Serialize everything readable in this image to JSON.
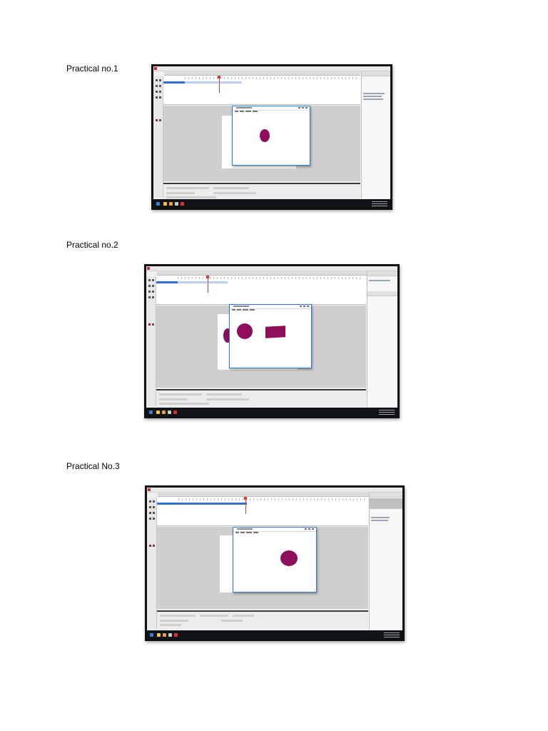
{
  "captions": [
    "Practical no.1",
    "Practical no.2",
    "Practical No.3"
  ],
  "shape_color": "#8e0e5c",
  "screenshots": [
    {
      "content": "Flash authoring window with test movie showing one ellipse",
      "shapes": [
        "ellipse"
      ]
    },
    {
      "content": "Flash authoring window with test movie showing two ellipses and a rectangle",
      "shapes": [
        "ellipse",
        "ellipse",
        "rectangle"
      ]
    },
    {
      "content": "Flash authoring window with test movie showing one ellipse",
      "shapes": [
        "ellipse"
      ]
    }
  ]
}
